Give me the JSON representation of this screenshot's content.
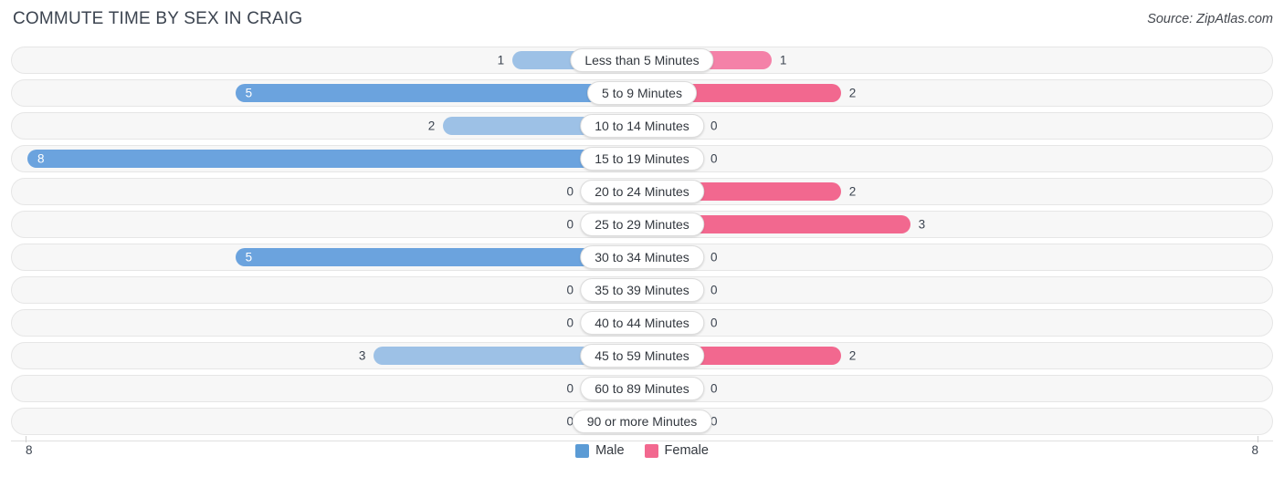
{
  "header": {
    "title": "COMMUTE TIME BY SEX IN CRAIG",
    "source": "Source: ZipAtlas.com"
  },
  "legend": {
    "items": [
      {
        "label": "Male",
        "color": "#5b9bd5"
      },
      {
        "label": "Female",
        "color": "#f2688f"
      }
    ]
  },
  "axis": {
    "left_tick": "8",
    "right_tick": "8",
    "max": 8
  },
  "colors": {
    "male_strong": "#6ba3de",
    "male_light": "#aac7e8",
    "female_strong": "#f2688f",
    "female_light": "#f9aec8",
    "row_bg": "#f7f7f7",
    "row_border": "#e6e6e6",
    "text": "#3c4450"
  },
  "chart_data": {
    "type": "bar",
    "title": "COMMUTE TIME BY SEX IN CRAIG",
    "subtype": "diverging-bidirectional",
    "xlabel": "",
    "ylabel": "",
    "xlim": [
      -8,
      8
    ],
    "grid": false,
    "legend_position": "bottom-center",
    "categories": [
      "Less than 5 Minutes",
      "5 to 9 Minutes",
      "10 to 14 Minutes",
      "15 to 19 Minutes",
      "20 to 24 Minutes",
      "25 to 29 Minutes",
      "30 to 34 Minutes",
      "35 to 39 Minutes",
      "40 to 44 Minutes",
      "45 to 59 Minutes",
      "60 to 89 Minutes",
      "90 or more Minutes"
    ],
    "series": [
      {
        "name": "Male",
        "values": [
          1,
          5,
          2,
          8,
          0,
          0,
          5,
          0,
          0,
          3,
          0,
          0
        ]
      },
      {
        "name": "Female",
        "values": [
          1,
          2,
          0,
          0,
          2,
          3,
          0,
          0,
          0,
          2,
          0,
          0
        ]
      }
    ]
  },
  "rows": [
    {
      "category": "Less than 5 Minutes",
      "male": "1",
      "female": "1",
      "male_v": 1,
      "female_v": 1
    },
    {
      "category": "5 to 9 Minutes",
      "male": "5",
      "female": "2",
      "male_v": 5,
      "female_v": 2
    },
    {
      "category": "10 to 14 Minutes",
      "male": "2",
      "female": "0",
      "male_v": 2,
      "female_v": 0
    },
    {
      "category": "15 to 19 Minutes",
      "male": "8",
      "female": "0",
      "male_v": 8,
      "female_v": 0
    },
    {
      "category": "20 to 24 Minutes",
      "male": "0",
      "female": "2",
      "male_v": 0,
      "female_v": 2
    },
    {
      "category": "25 to 29 Minutes",
      "male": "0",
      "female": "3",
      "male_v": 0,
      "female_v": 3
    },
    {
      "category": "30 to 34 Minutes",
      "male": "5",
      "female": "0",
      "male_v": 5,
      "female_v": 0
    },
    {
      "category": "35 to 39 Minutes",
      "male": "0",
      "female": "0",
      "male_v": 0,
      "female_v": 0
    },
    {
      "category": "40 to 44 Minutes",
      "male": "0",
      "female": "0",
      "male_v": 0,
      "female_v": 0
    },
    {
      "category": "45 to 59 Minutes",
      "male": "3",
      "female": "2",
      "male_v": 3,
      "female_v": 2
    },
    {
      "category": "60 to 89 Minutes",
      "male": "0",
      "female": "0",
      "male_v": 0,
      "female_v": 0
    },
    {
      "category": "90 or more Minutes",
      "male": "0",
      "female": "0",
      "male_v": 0,
      "female_v": 0
    }
  ]
}
